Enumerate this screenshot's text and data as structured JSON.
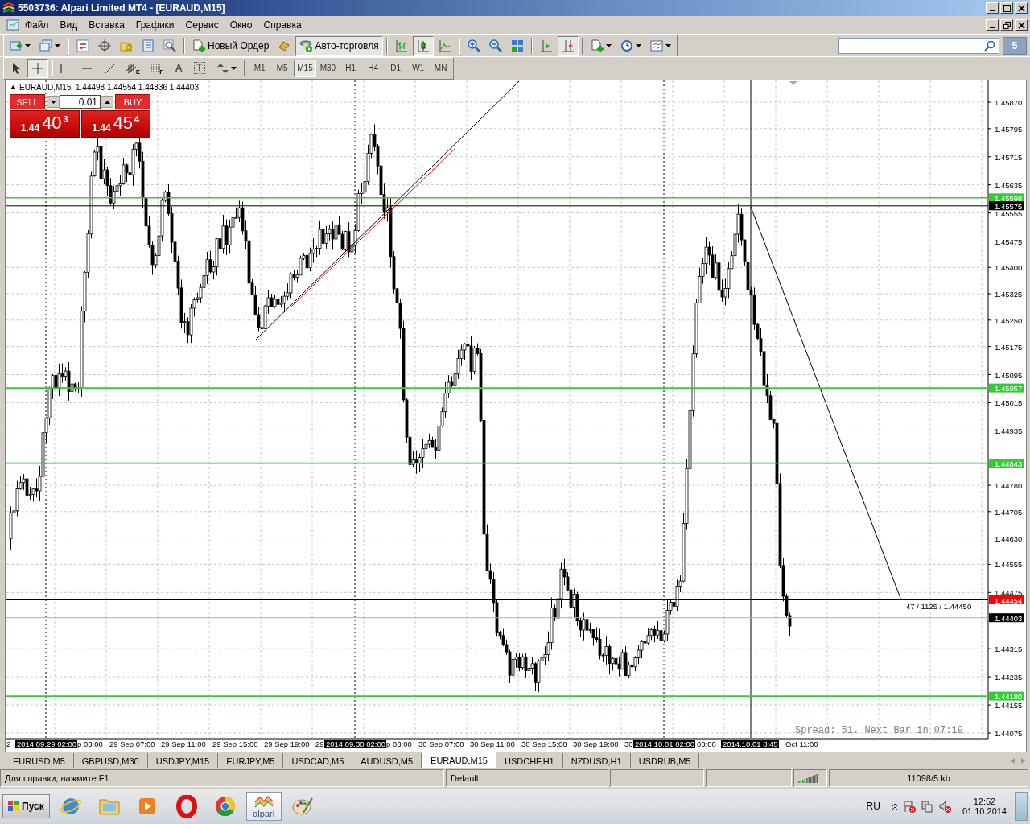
{
  "window": {
    "title": "5503736: Alpari Limited MT4 - [EURAUD,M15]"
  },
  "menu": [
    "Файл",
    "Вид",
    "Вставка",
    "Графики",
    "Сервис",
    "Окно",
    "Справка"
  ],
  "toolbar": {
    "groups": [
      [
        {
          "kind": "dropdown",
          "selected": false
        },
        {
          "kind": "dropdown",
          "selected": false
        }
      ],
      [
        {
          "kind": "icon",
          "selected": false
        },
        {
          "kind": "icon",
          "selected": false
        },
        {
          "kind": "icon",
          "selected": false
        },
        {
          "kind": "icon",
          "selected": false
        },
        {
          "kind": "icon",
          "selected": false
        }
      ],
      [
        {
          "kind": "labeled",
          "label": "Новый Ордер",
          "selected": false
        },
        {
          "kind": "icon",
          "selected": false
        },
        {
          "kind": "labeled",
          "label": "Авто-торговля",
          "selected": true
        }
      ],
      [
        {
          "kind": "icon",
          "selected": false
        },
        {
          "kind": "icon",
          "selected": true
        },
        {
          "kind": "icon",
          "selected": false
        }
      ],
      [
        {
          "kind": "icon",
          "selected": false
        },
        {
          "kind": "icon",
          "selected": false
        },
        {
          "kind": "icon",
          "selected": false
        }
      ],
      [
        {
          "kind": "icon",
          "selected": false
        },
        {
          "kind": "icon",
          "selected": true
        }
      ],
      [
        {
          "kind": "dropdown",
          "selected": false
        },
        {
          "kind": "dropdown",
          "selected": false
        },
        {
          "kind": "dropdown",
          "selected": false
        }
      ]
    ]
  },
  "messages_badge": "5",
  "drawing_tools": [
    {
      "kind": "icon",
      "selected": false
    },
    {
      "kind": "icon",
      "selected": true
    },
    {
      "kind": "icon",
      "selected": false
    },
    {
      "kind": "icon",
      "selected": false
    },
    {
      "kind": "icon",
      "selected": false
    },
    {
      "kind": "lettered",
      "label": "E",
      "selected": false
    },
    {
      "kind": "lettered",
      "label": "F",
      "selected": false
    },
    {
      "kind": "letter",
      "label": "A",
      "selected": false
    },
    {
      "kind": "boxed",
      "label": "T",
      "selected": false
    },
    {
      "kind": "dropdown",
      "selected": false
    }
  ],
  "timeframes": [
    {
      "label": "M1",
      "selected": false
    },
    {
      "label": "M5",
      "selected": false
    },
    {
      "label": "M15",
      "selected": true
    },
    {
      "label": "M30",
      "selected": false
    },
    {
      "label": "H1",
      "selected": false
    },
    {
      "label": "H4",
      "selected": false
    },
    {
      "label": "D1",
      "selected": false
    },
    {
      "label": "W1",
      "selected": false
    },
    {
      "label": "MN",
      "selected": false
    }
  ],
  "chart": {
    "header": "EURAUD,M15  1.44498 1.44554 1.44336 1.44403",
    "trade_panel": {
      "sell_label": "SELL",
      "buy_label": "BUY",
      "lot": "0.01",
      "sell_price": {
        "prefix": "1.44",
        "main": "40",
        "sup": "3"
      },
      "buy_price": {
        "prefix": "1.44",
        "main": "45",
        "sup": "4"
      }
    },
    "price_ticks": [
      "1.45870",
      "1.45795",
      "1.45715",
      "1.45635",
      "1.45555",
      "1.45475",
      "1.45400",
      "1.45325",
      "1.45250",
      "1.45175",
      "1.45095",
      "1.45015",
      "1.44935",
      "1.44780",
      "1.44705",
      "1.44630",
      "1.44555",
      "1.44475",
      "1.44315",
      "1.44235",
      "1.44155",
      "1.44075"
    ],
    "price_lines": [
      {
        "price": "1.45598",
        "kind": "level",
        "color": "#32cd32"
      },
      {
        "price": "1.45575",
        "kind": "marker",
        "color": "#000000"
      },
      {
        "price": "1.45057",
        "kind": "level",
        "color": "#32cd32"
      },
      {
        "price": "1.44843",
        "kind": "level",
        "color": "#32cd32"
      },
      {
        "price": "1.44454",
        "kind": "ask",
        "color": "#ff0000"
      },
      {
        "price": "1.44403",
        "kind": "bid",
        "color": "#000000"
      },
      {
        "price": "1.44180",
        "kind": "level",
        "color": "#32cd32"
      }
    ],
    "trendline_label": "47 / 1125 / 1.44450",
    "info": "Spread: 51. Next Bar in 07:19",
    "time_ticks": [
      "2",
      "p 03:00",
      "29 Sep 07:00",
      "29 Sep 11:00",
      "29 Sep 15:00",
      "29 Sep 19:00",
      "29",
      "p 03:00",
      "30 Sep 07:00",
      "30 Sep 11:00",
      "30 Sep 15:00",
      "30 Sep 19:00",
      "30",
      "03:00",
      "Oct 11:00"
    ],
    "time_markers": [
      "2014.09.29 02:00",
      "2014.09.30 02:00",
      "2014.10.01 02:00",
      "2014.10.01 8:45"
    ]
  },
  "chart_tabs": [
    {
      "label": "EURUSD,M5",
      "selected": false
    },
    {
      "label": "GBPUSD,M30",
      "selected": false
    },
    {
      "label": "USDJPY,M15",
      "selected": false
    },
    {
      "label": "EURJPY,M5",
      "selected": false
    },
    {
      "label": "USDCAD,M5",
      "selected": false
    },
    {
      "label": "AUDUSD,M5",
      "selected": false
    },
    {
      "label": "EURAUD,M15",
      "selected": true
    },
    {
      "label": "USDCHF,H1",
      "selected": false
    },
    {
      "label": "NZDUSD,H1",
      "selected": false
    },
    {
      "label": "USDRUB,M5",
      "selected": false
    }
  ],
  "status_bar": {
    "help": "Для справки, нажмите F1",
    "profile": "Default",
    "traffic": "11098/5 kb"
  },
  "taskbar": {
    "start": "Пуск",
    "apps": [
      {
        "kind": "ie",
        "selected": false
      },
      {
        "kind": "folder",
        "selected": false
      },
      {
        "kind": "player",
        "selected": false
      },
      {
        "kind": "opera",
        "selected": false
      },
      {
        "kind": "chrome",
        "selected": false
      },
      {
        "kind": "alpari",
        "label": "alpari",
        "selected": true
      },
      {
        "kind": "paint",
        "selected": false
      }
    ],
    "language": "RU",
    "time": "12:52",
    "date": "01.10.2014"
  }
}
